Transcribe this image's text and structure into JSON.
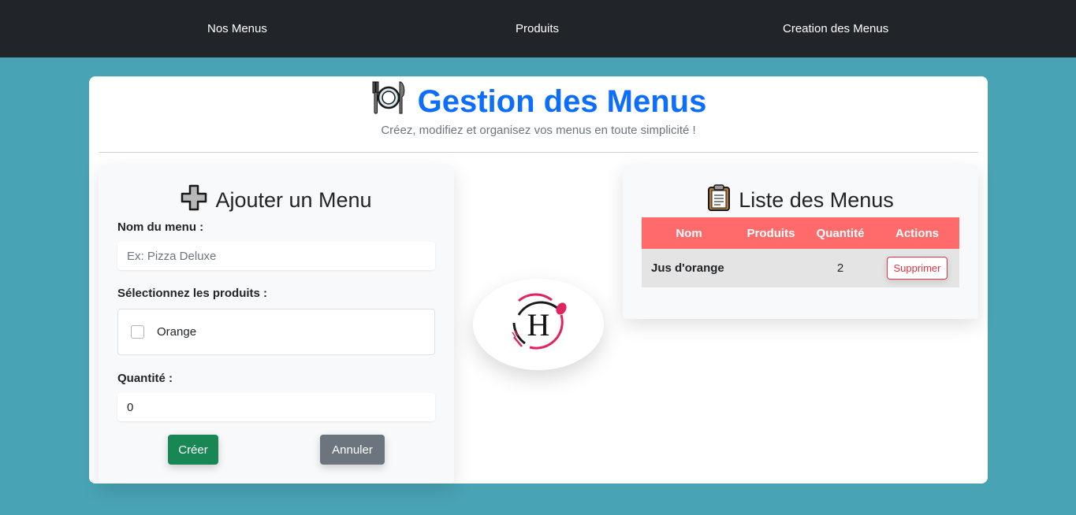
{
  "nav": {
    "items": [
      "Nos Menus",
      "Produits",
      "Creation des Menus"
    ]
  },
  "header": {
    "icon": "plate-cutlery-icon",
    "title": "Gestion des Menus",
    "subtitle": "Créez, modifiez et organisez vos menus en toute simplicité !"
  },
  "form": {
    "title": "Ajouter un Menu",
    "name_label": "Nom du menu :",
    "name_placeholder": "Ex: Pizza Deluxe",
    "name_value": "",
    "products_label": "Sélectionnez les produits :",
    "products": [
      {
        "label": "Orange",
        "checked": false
      }
    ],
    "quantity_label": "Quantité :",
    "quantity_value": "0",
    "create_label": "Créer",
    "cancel_label": "Annuler"
  },
  "list": {
    "title": "Liste des Menus",
    "columns": [
      "Nom",
      "Produits",
      "Quantité",
      "Actions"
    ],
    "rows": [
      {
        "nom": "Jus d'orange",
        "produits": "",
        "quantite": "2",
        "action": "Supprimer"
      }
    ]
  },
  "colors": {
    "navbar": "#212529",
    "background": "#48a3b5",
    "title": "#0d6efd",
    "table_header": "#ff6b6b",
    "create_button": "#198754",
    "cancel_button": "#6c757d",
    "delete": "#dc3545",
    "logo_accent": "#e0245e"
  }
}
